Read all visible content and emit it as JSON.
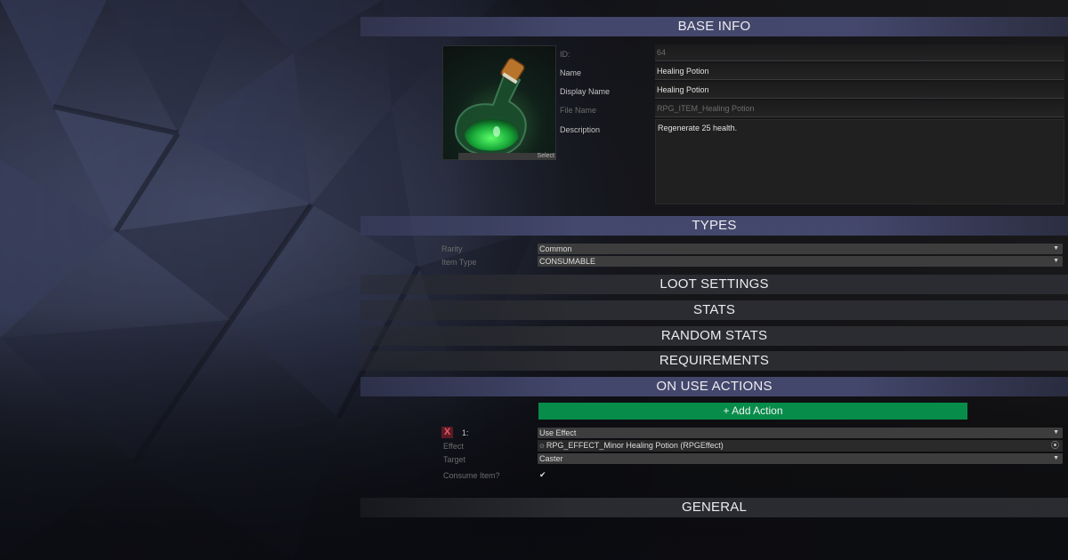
{
  "sections": {
    "base_info": "BASE INFO",
    "types": "TYPES",
    "loot_settings": "LOOT SETTINGS",
    "stats": "STATS",
    "random_stats": "RANDOM STATS",
    "requirements": "REQUIREMENTS",
    "on_use_actions": "ON USE ACTIONS",
    "general": "GENERAL"
  },
  "base_info": {
    "icon_select_label": "Select",
    "id": {
      "label": "ID:",
      "value": "64"
    },
    "name": {
      "label": "Name",
      "value": "Healing Potion"
    },
    "display_name": {
      "label": "Display Name",
      "value": "Healing Potion"
    },
    "file_name": {
      "label": "File Name",
      "value": "RPG_ITEM_Healing Potion"
    },
    "description": {
      "label": "Description",
      "value": "Regenerate 25 health."
    }
  },
  "types": {
    "rarity": {
      "label": "Rarity",
      "value": "Common"
    },
    "item_type": {
      "label": "Item Type",
      "value": "CONSUMABLE"
    }
  },
  "on_use_actions": {
    "add_action_label": "+ Add Action",
    "actions": [
      {
        "delete_label": "X",
        "index_label": "1:",
        "action_type": "Use Effect",
        "effect": {
          "label": "Effect",
          "value": "RPG_EFFECT_Minor Healing Potion (RPGEffect)"
        },
        "target": {
          "label": "Target",
          "value": "Caster"
        },
        "consume_item": {
          "label": "Consume Item?",
          "checked": true,
          "mark": "✔"
        }
      }
    ]
  },
  "icons": {
    "dropdown_arrow": "▼",
    "object_picker": "⦿",
    "object_reference": "⊙"
  },
  "colors": {
    "section_open": "#464a70",
    "add_action_button": "#078c4a",
    "delete_button": "#5c1a24"
  }
}
